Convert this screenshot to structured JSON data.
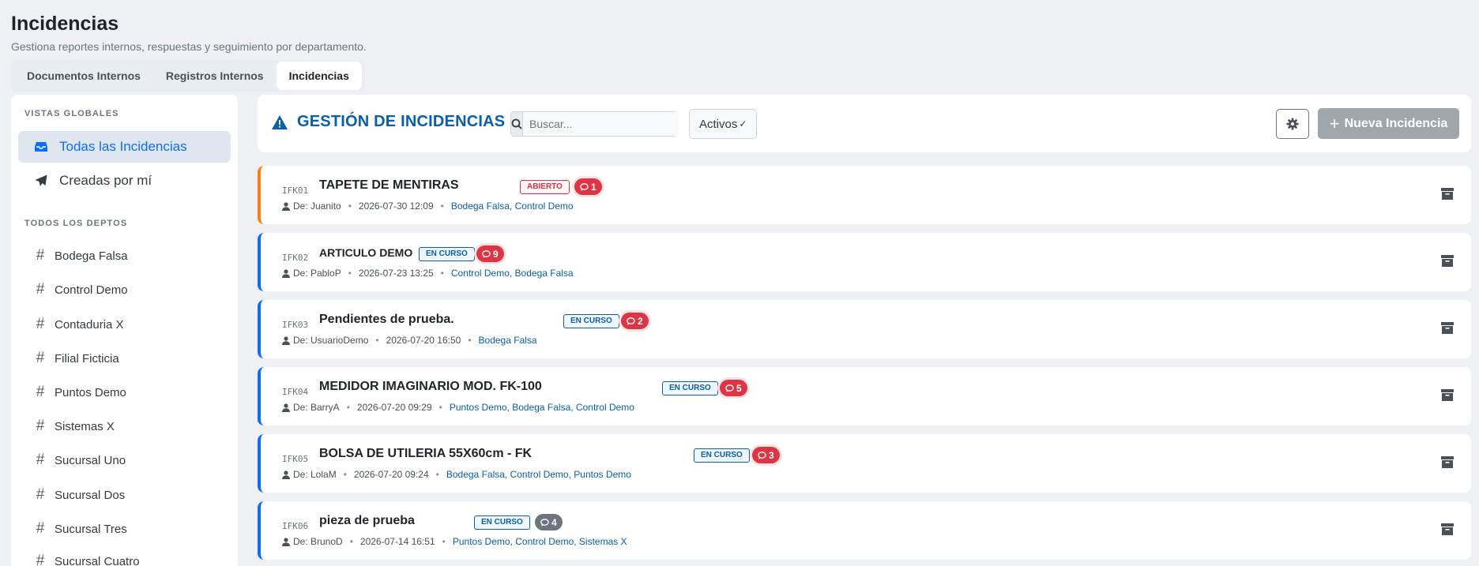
{
  "page": {
    "title": "Incidencias",
    "subtitle": "Gestiona reportes internos, respuestas y seguimiento por departamento."
  },
  "tabs": [
    {
      "label": "Documentos Internos",
      "active": false
    },
    {
      "label": "Registros Internos",
      "active": false
    },
    {
      "label": "Incidencias",
      "active": true
    }
  ],
  "sidebar": {
    "global_heading": "VISTAS GLOBALES",
    "views": [
      {
        "label": "Todas las Incidencias",
        "icon": "inbox-icon",
        "active": true
      },
      {
        "label": "Creadas por mí",
        "icon": "send-icon",
        "active": false
      }
    ],
    "depts_heading": "TODOS LOS DEPTOS",
    "depts": [
      "Bodega Falsa",
      "Control Demo",
      "Contaduria X",
      "Filial Ficticia",
      "Puntos Demo",
      "Sistemas X",
      "Sucursal Uno",
      "Sucursal Dos",
      "Sucursal Tres",
      "Sucursal Cuatro"
    ]
  },
  "header": {
    "title": "GESTIÓN DE INCIDENCIAS",
    "icon": "warning-icon",
    "search_placeholder": "Buscar...",
    "filter_value": "Activos",
    "settings_icon": "gear-icon",
    "new_button": "Nueva Incidencia"
  },
  "incidents": [
    {
      "code": "IFK01",
      "title": "TAPETE DE MENTIRAS",
      "status": "ABIERTO",
      "messages": "1",
      "author": "De: Juanito",
      "date": "2026-07-30 12:09",
      "depts": "Bodega Falsa, Control Demo"
    },
    {
      "code": "IFK02",
      "title": "ARTICULO DEMO",
      "status": "EN CURSO",
      "messages": "9",
      "author": "De: PabloP",
      "date": "2026-07-23 13:25",
      "depts": "Control Demo, Bodega Falsa"
    },
    {
      "code": "IFK03",
      "title": "Pendientes de prueba.",
      "status": "EN CURSO",
      "messages": "2",
      "author": "De: UsuarioDemo",
      "date": "2026-07-20 16:50",
      "depts": "Bodega Falsa"
    },
    {
      "code": "IFK04",
      "title": "MEDIDOR IMAGINARIO MOD. FK-100",
      "status": "EN CURSO",
      "messages": "5",
      "author": "De: BarryA",
      "date": "2026-07-20 09:29",
      "depts": "Puntos Demo, Bodega Falsa, Control Demo"
    },
    {
      "code": "IFK05",
      "title": "BOLSA DE UTILERIA 55X60cm - FK",
      "status": "EN CURSO",
      "messages": "3",
      "author": "De: LolaM",
      "date": "2026-07-20 09:24",
      "depts": "Bodega Falsa, Control Demo, Puntos Demo"
    },
    {
      "code": "IFK06",
      "title": "pieza de prueba",
      "status": "EN CURSO",
      "messages": "4",
      "author": "De: BrunoD",
      "date": "2026-07-14 16:51",
      "depts": "Puntos Demo, Control Demo, Sistemas X"
    }
  ],
  "colors": {
    "accent": "#0b5ea8",
    "danger": "#dc3545",
    "open_border": "#fd7e14"
  }
}
